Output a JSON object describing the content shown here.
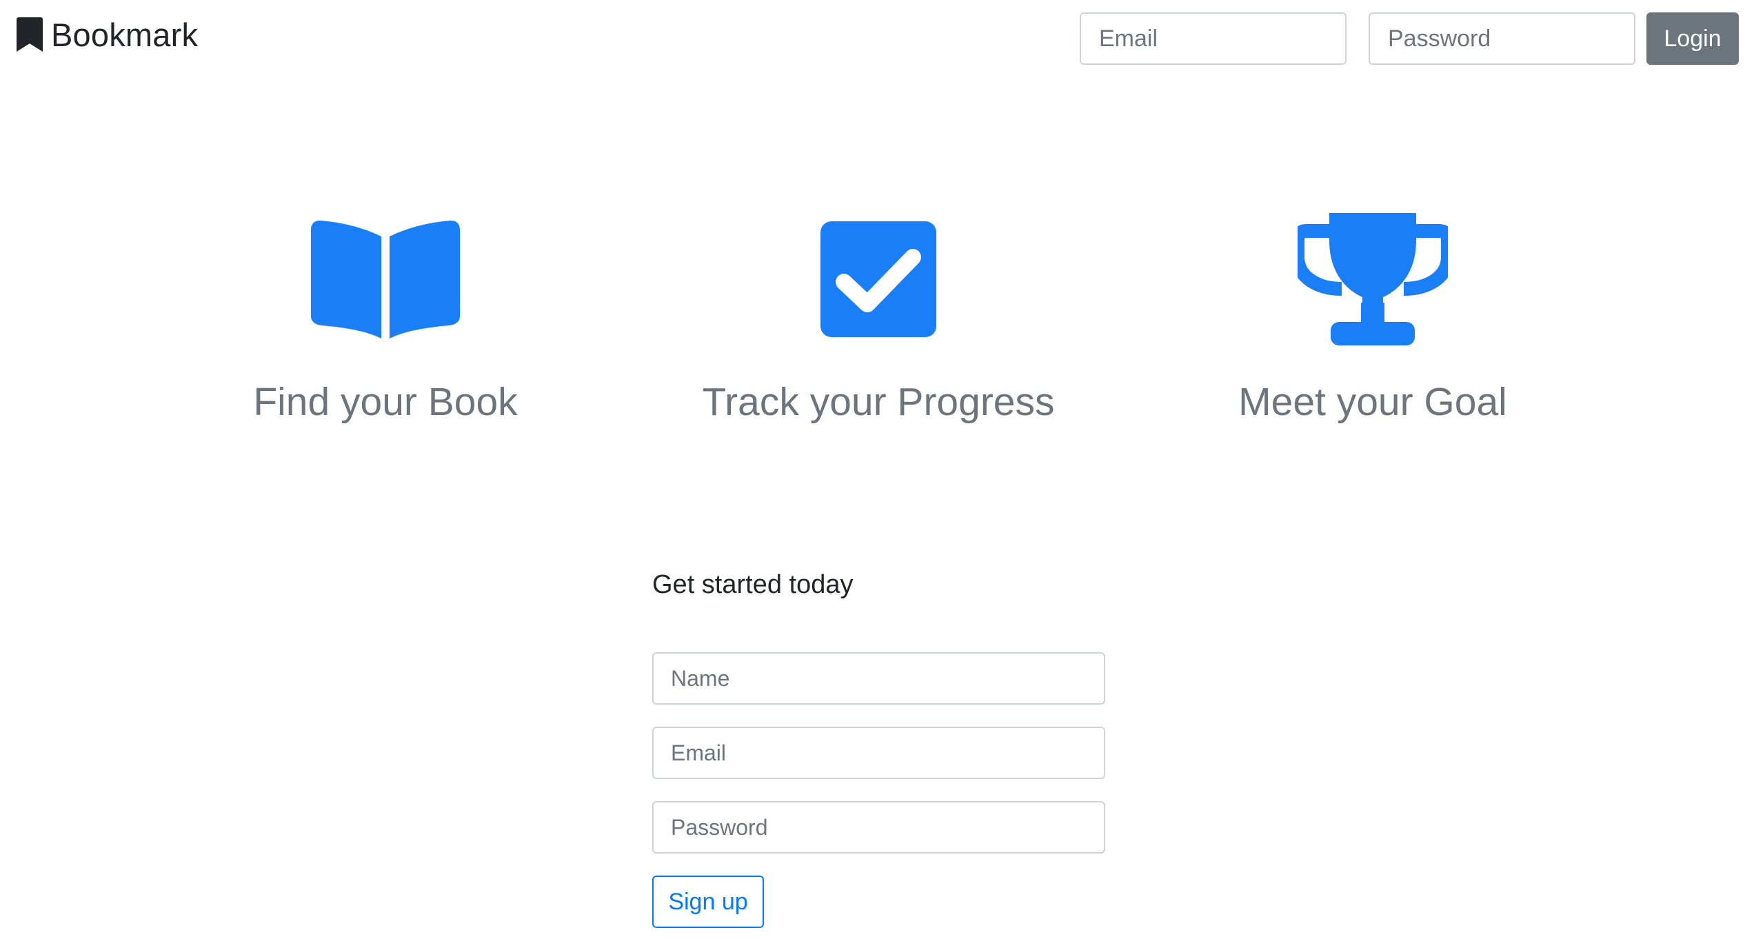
{
  "navbar": {
    "brand": "Bookmark",
    "brand_icon": "bookmark-icon",
    "email_placeholder": "Email",
    "password_placeholder": "Password",
    "login_label": "Login"
  },
  "features": [
    {
      "icon": "open-book-icon",
      "title": "Find your Book"
    },
    {
      "icon": "check-square-icon",
      "title": "Track your Progress"
    },
    {
      "icon": "trophy-icon",
      "title": "Meet your Goal"
    }
  ],
  "signup": {
    "heading": "Get started today",
    "name_placeholder": "Name",
    "email_placeholder": "Email",
    "password_placeholder": "Password",
    "submit_label": "Sign up"
  },
  "colors": {
    "accent": "#1a7ff7",
    "primary_outline": "#007bff",
    "secondary": "#6c757d",
    "text": "#212529"
  }
}
